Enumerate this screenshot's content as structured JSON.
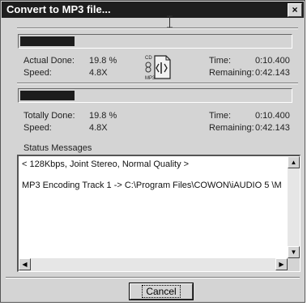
{
  "window": {
    "title": "Convert to MP3 file...",
    "close_label": "×"
  },
  "track_progress": {
    "fill_fraction": 0.2,
    "done_label": "Actual Done:",
    "done_value": "19.8 %",
    "speed_label": "Speed:",
    "speed_value": "4.8X",
    "time_label": "Time:",
    "time_value": "0:10.400",
    "remaining_label": "Remaining:",
    "remaining_value": "0:42.143"
  },
  "total_progress": {
    "fill_fraction": 0.2,
    "done_label": "Totally Done:",
    "done_value": "19.8 %",
    "speed_label": "Speed:",
    "speed_value": "4.8X",
    "time_label": "Time:",
    "time_value": "0:10.400",
    "remaining_label": "Remaining:",
    "remaining_value": "0:42.143"
  },
  "status": {
    "label": "Status Messages",
    "lines": [
      "< 128Kbps, Joint Stereo, Normal Quality >",
      "MP3 Encoding Track  1 -> C:\\Program Files\\COWON\\iAUDIO 5   \\M"
    ]
  },
  "convert_icon": {
    "name": "cd-to-mp3-icon",
    "cd_text": "CD",
    "mp3_text": "MP3"
  },
  "buttons": {
    "cancel_label": "Cancel"
  }
}
